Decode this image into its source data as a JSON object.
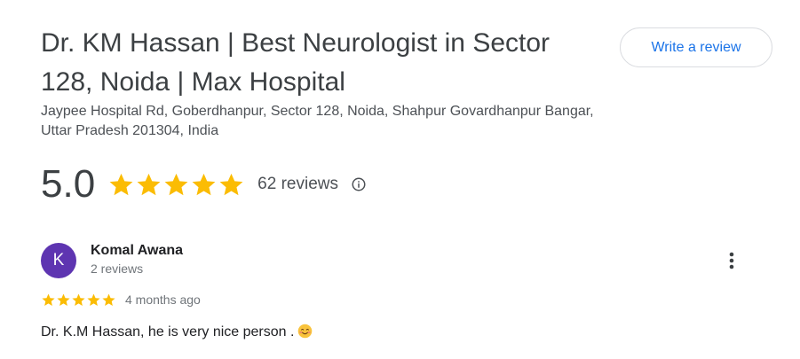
{
  "place": {
    "title": "Dr. KM Hassan | Best Neurologist in Sector 128, Noida | Max Hospital",
    "address": "Jaypee Hospital Rd, Goberdhanpur, Sector 128, Noida, Shahpur Govardhanpur Bangar, Uttar Pradesh 201304, India"
  },
  "actions": {
    "write_review_label": "Write a review"
  },
  "rating": {
    "value": "5.0",
    "stars": 5,
    "reviews_label": "62 reviews",
    "info_icon": "info-circle-icon"
  },
  "review": {
    "avatar_initial": "K",
    "avatar_color": "#5e35b1",
    "name": "Komal Awana",
    "meta": "2 reviews",
    "stars": 5,
    "date": "4 months ago",
    "text": "Dr. K.M Hassan, he is very nice person .",
    "emoji": "smiling-face-icon",
    "more_icon": "more-vertical-icon"
  },
  "colors": {
    "star": "#fbbc04",
    "link": "#1a73e8"
  }
}
